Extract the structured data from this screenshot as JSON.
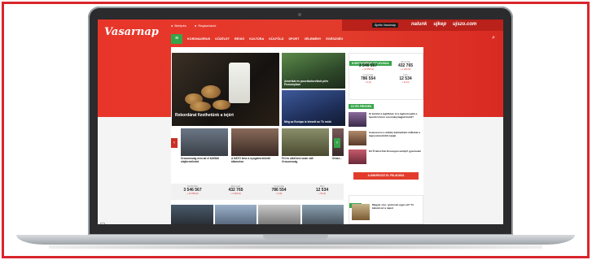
{
  "site": {
    "logo": "Vasarnap",
    "topbar": {
      "login": "Belépés",
      "register": "Regisztráció"
    },
    "april_button": "Április Vasárnap",
    "brands": [
      "nalunk",
      "ujkep",
      "ujszo.com"
    ],
    "nav": [
      "KORONAVÍRUS",
      "KÖZÉLET",
      "RÉGIÓ",
      "KULTÚRA",
      "KÜLFÖLD",
      "SPORT",
      "VÉLEMÉNY",
      "EGÉSZSÉG"
    ]
  },
  "featured": {
    "title": "Rekordárat fizethetünk a tejért"
  },
  "tiles": [
    {
      "caption": "Amerikai és posztbolsevikok plés Pozsonyban"
    },
    {
      "caption": "Még az Európa is kiesett az Tk móló"
    }
  ],
  "strip": [
    {
      "text": "Oroszország nem ad el külföldi olajtermékeket"
    },
    {
      "text": "A NATO kész a nyugatra tekintő államokra"
    },
    {
      "text": "Fél és utált kézi uram vált Oroszország"
    },
    {
      "text": "Orosz..."
    }
  ],
  "covid_bottom": {
    "badge": "KORONAVÍRUS SZLOVÁKIA",
    "cells": [
      {
        "label": "Fertőzöttek",
        "value": "3 546 567",
        "delta": "+ 12 259 (ő)"
      },
      {
        "label": "Elhunytak",
        "value": "432 765",
        "delta": "+ 1 234 (ő)"
      },
      {
        "label": "Gyógyultak",
        "value": "786 554",
        "delta": "+ 6 (ő)"
      },
      {
        "label": "Aktív",
        "value": "12 534",
        "delta": "+ 34 (ő)"
      }
    ]
  },
  "covid_side": {
    "badge": "KORONAVÍRUS SZLOVÁKIA",
    "cells": [
      {
        "label": "Fertőzöttek",
        "value": "3 546 567",
        "delta": "+ 12 259 (ő)"
      },
      {
        "label": "Elhunytak",
        "value": "432 765",
        "delta": "+ 1 234 (ő)"
      },
      {
        "label": "Gyógyultak",
        "value": "786 554",
        "delta": "+ 6 (ő)"
      },
      {
        "label": "Aktív",
        "value": "12 534",
        "delta": "+ 34 (ő)"
      }
    ]
  },
  "fresh": {
    "badge": "ÚJ ÉS FRISSEK",
    "items": [
      {
        "text": "Ki kerület a legfőbbet, ki a legfontosabb a leendő trónon a kormánytagjait közül?"
      },
      {
        "text": "Ceausescu a székely kabinetként milliókat a legnyomasztóbb napjai"
      },
      {
        "text": "EZ Ő lehet Kim Dzsongun utódja? gyermeke!"
      }
    ]
  },
  "red_button": "AJÁNDÉKOZZ EL FELADÁSA",
  "kave": {
    "badge": "KÁVÉ",
    "text": "Magyar vicc, pontosan ugye ezt? Te kaland ezt a napot"
  },
  "colors": {
    "brand_red": "#e23b2c",
    "green": "#36a54a",
    "dark": "#1c1c1c"
  }
}
